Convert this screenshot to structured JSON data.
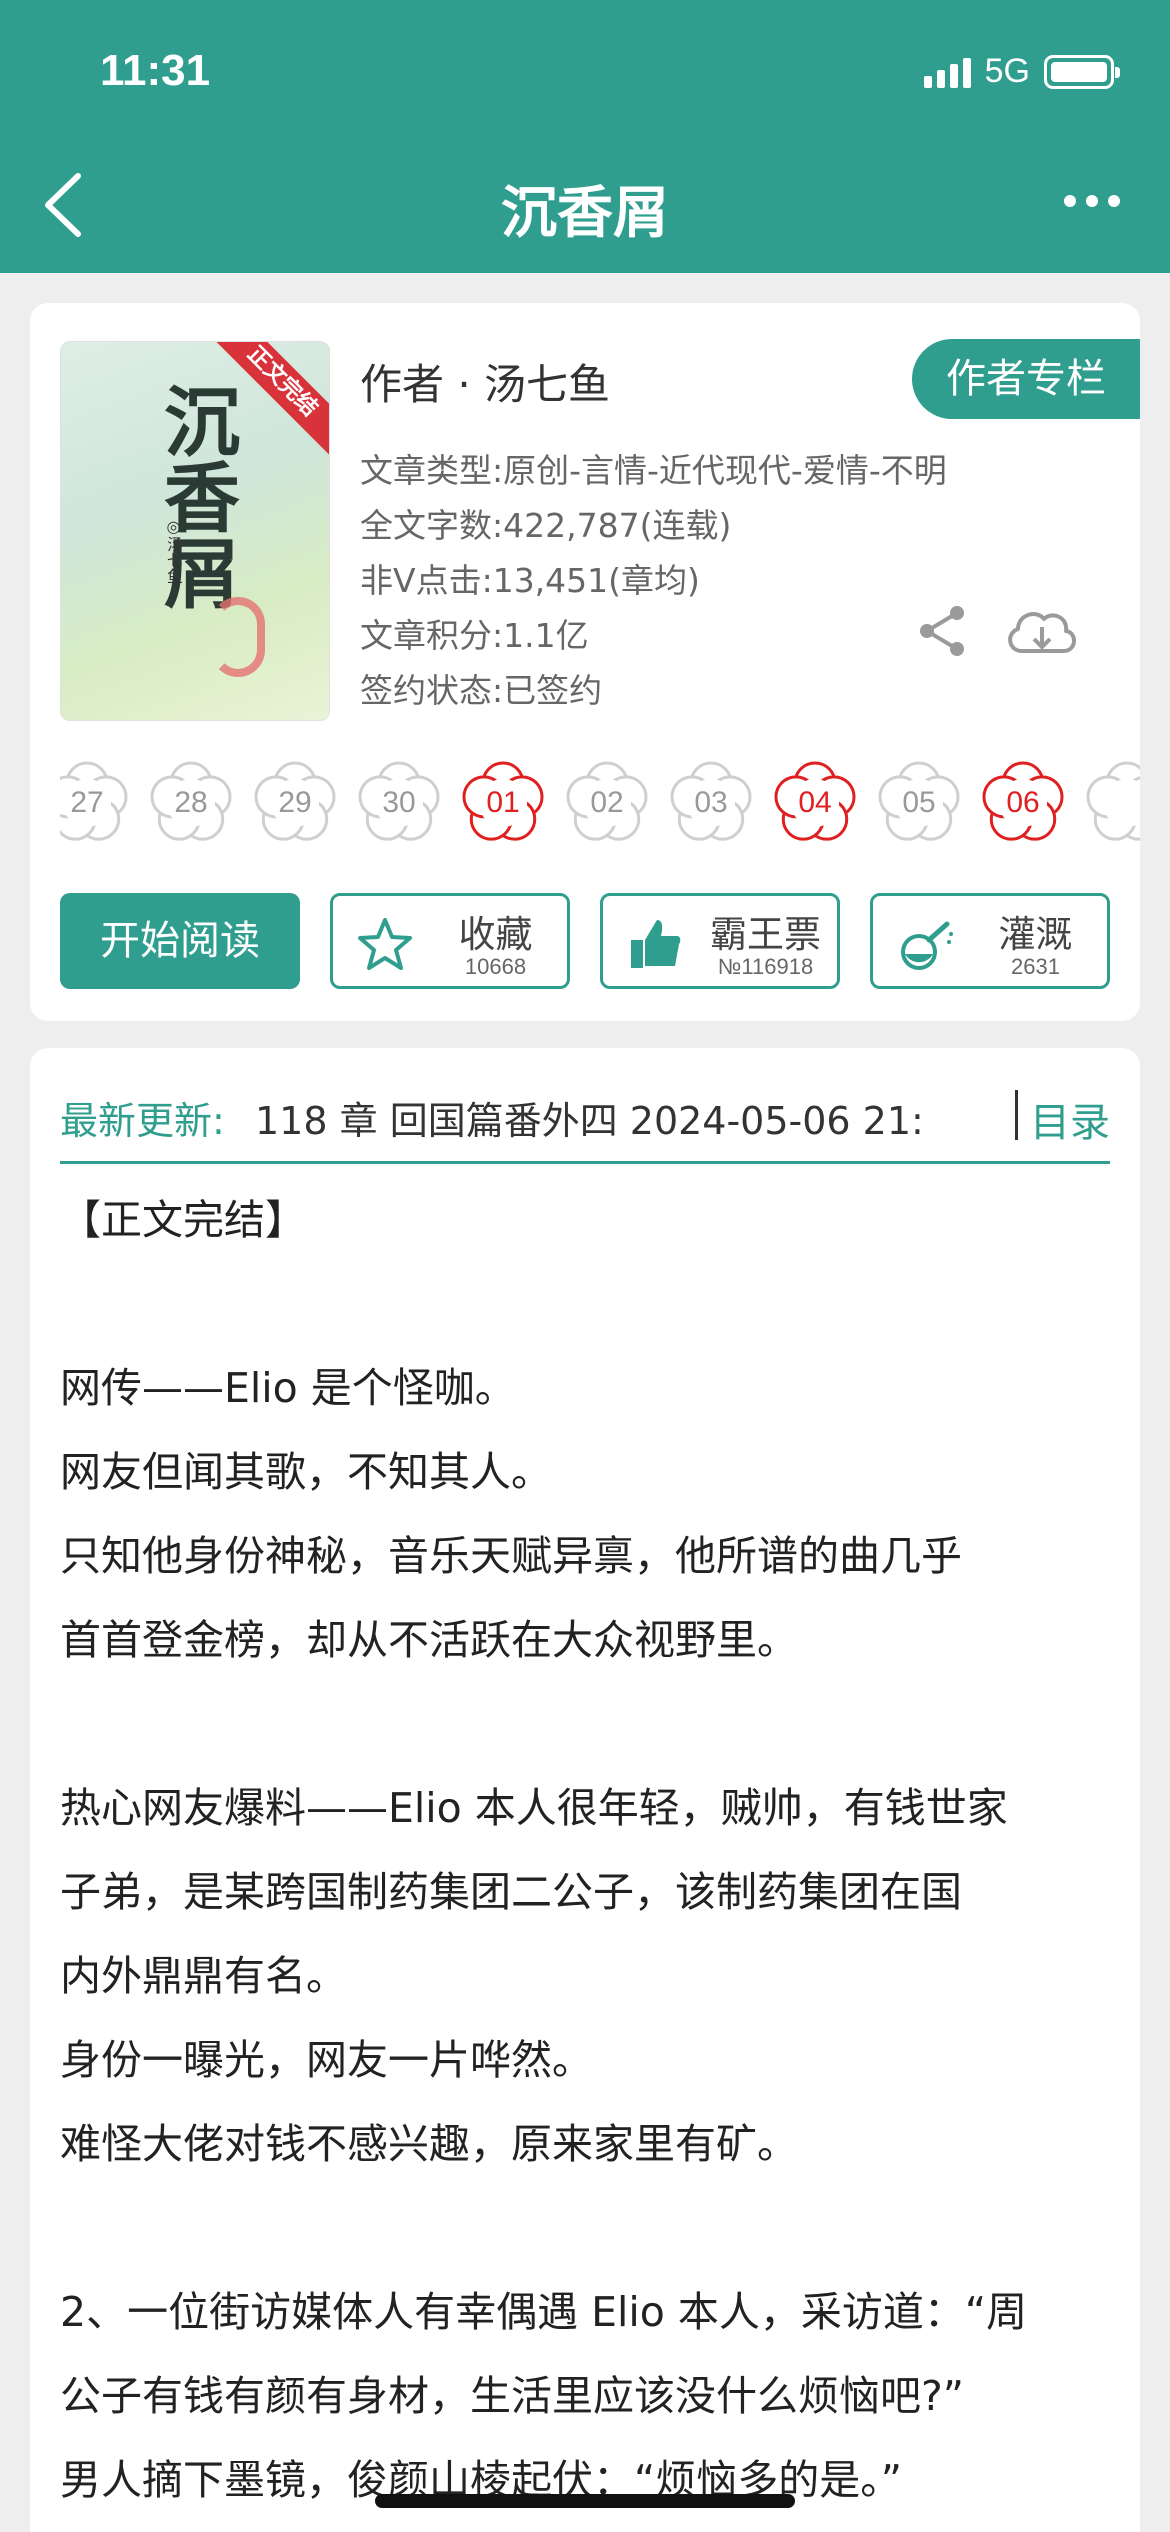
{
  "status_bar": {
    "time": "11:31",
    "network": "5G"
  },
  "nav": {
    "title": "沉香屑"
  },
  "book": {
    "cover_title": "沉香屑",
    "cover_ribbon": "正文完结",
    "cover_author": "◎汤七鱼",
    "author_line": "作者 · 汤七鱼",
    "author_column_label": "作者专栏",
    "meta": [
      "文章类型:原创-言情-近代现代-爱情-不明",
      "全文字数:422,787(连载)",
      "非Ⅴ点击:13,451(章均)",
      "文章积分:1.1亿",
      "签约状态:已签约"
    ]
  },
  "days": [
    {
      "num": "27",
      "hit": false
    },
    {
      "num": "28",
      "hit": false
    },
    {
      "num": "29",
      "hit": false
    },
    {
      "num": "30",
      "hit": false
    },
    {
      "num": "01",
      "hit": true
    },
    {
      "num": "02",
      "hit": false
    },
    {
      "num": "03",
      "hit": false
    },
    {
      "num": "04",
      "hit": true
    },
    {
      "num": "05",
      "hit": false
    },
    {
      "num": "06",
      "hit": true
    },
    {
      "num": "",
      "hit": false
    }
  ],
  "actions": {
    "read_label": "开始阅读",
    "favorite": {
      "label": "收藏",
      "count": "10668"
    },
    "ticket": {
      "label": "霸王票",
      "count": "№116918"
    },
    "water": {
      "label": "灌溉",
      "count": "2631"
    }
  },
  "update": {
    "label": "最新更新:",
    "text": "118 章 回国篇番外四 2024-05-06 21:",
    "toc_label": "目录"
  },
  "paragraphs": [
    "【正文完结】",
    "",
    "网传——Elio 是个怪咖。",
    "网友但闻其歌，不知其人。",
    "只知他身份神秘，音乐天赋异禀，他所谱的曲几乎",
    "首首登金榜，却从不活跃在大众视野里。",
    "",
    "热心网友爆料——Elio 本人很年轻，贼帅，有钱世家",
    "子弟，是某跨国制药集团二公子，该制药集团在国",
    "内外鼎鼎有名。",
    "身份一曝光，网友一片哗然。",
    "难怪大佬对钱不感兴趣，原来家里有矿。",
    "",
    "2、一位街访媒体人有幸偶遇 Elio 本人，采访道：“周",
    "公子有钱有颜有身材，生活里应该没什么烦恼吧?”",
    "男人摘下墨镜，俊颜山棱起伏：“烦恼多的是。”"
  ]
}
